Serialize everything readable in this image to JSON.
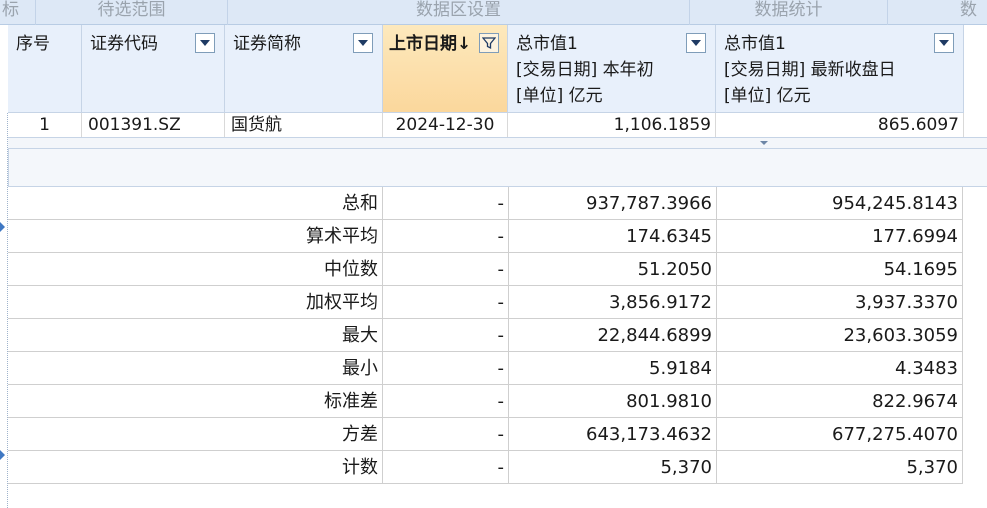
{
  "sections": [
    "标",
    "待选范围",
    "数据区设置",
    "数据统计",
    "数"
  ],
  "headers": {
    "seq": "序号",
    "code": "证券代码",
    "name": "证券简称",
    "listing_date": "上市日期",
    "sort_arrow": "↓",
    "mv_start": [
      "总市值1",
      "[交易日期] 本年初",
      "[单位] 亿元"
    ],
    "mv_latest": [
      "总市值1",
      "[交易日期] 最新收盘日",
      "[单位] 亿元"
    ]
  },
  "row": {
    "seq": "1",
    "code": "001391.SZ",
    "name": "国货航",
    "listing_date": "2024-12-30",
    "mv_start": "1,106.1859",
    "mv_latest": "865.6097"
  },
  "stats": [
    {
      "label": "总和",
      "date": "-",
      "mv_start": "937,787.3966",
      "mv_latest": "954,245.8143"
    },
    {
      "label": "算术平均",
      "date": "-",
      "mv_start": "174.6345",
      "mv_latest": "177.6994"
    },
    {
      "label": "中位数",
      "date": "-",
      "mv_start": "51.2050",
      "mv_latest": "54.1695"
    },
    {
      "label": "加权平均",
      "date": "-",
      "mv_start": "3,856.9172",
      "mv_latest": "3,937.3370"
    },
    {
      "label": "最大",
      "date": "-",
      "mv_start": "22,844.6899",
      "mv_latest": "23,603.3059"
    },
    {
      "label": "最小",
      "date": "-",
      "mv_start": "5.9184",
      "mv_latest": "4.3483"
    },
    {
      "label": "标准差",
      "date": "-",
      "mv_start": "801.9810",
      "mv_latest": "822.9674"
    },
    {
      "label": "方差",
      "date": "-",
      "mv_start": "643,173.4632",
      "mv_latest": "677,275.4070"
    },
    {
      "label": "计数",
      "date": "-",
      "mv_start": "5,370",
      "mv_latest": "5,370"
    }
  ],
  "icons": {
    "filter_dropdown": "chevron-down-icon",
    "filter_active": "funnel-icon"
  },
  "colors": {
    "header_bg": "#e8f0fb",
    "sorted_header_bg": "#fbd79c",
    "tabbar_bg": "#dde8f6"
  }
}
